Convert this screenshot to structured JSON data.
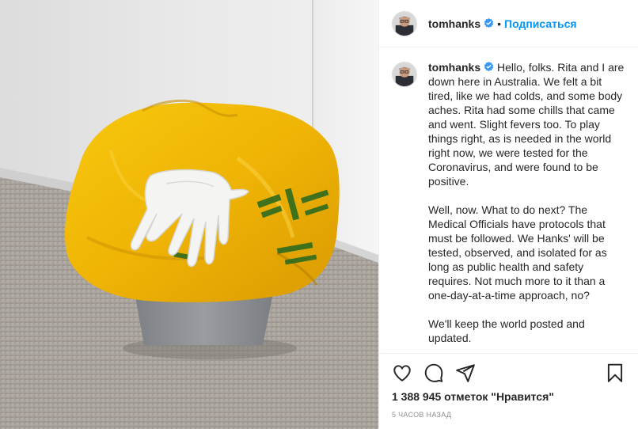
{
  "header": {
    "username": "tomhanks",
    "separator": "•",
    "follow_label": "Подписаться"
  },
  "caption": {
    "username": "tomhanks",
    "paragraphs": [
      "Hello, folks. Rita and I are down here in Australia. We felt a bit tired, like we had colds, and some body aches. Rita had some chills that came and went. Slight fevers too. To play things right, as is needed in the world right now, we were tested for the Coronavirus, and were found to be positive.",
      "Well, now. What to do next? The Medical Officials have protocols that must be followed. We Hanks' will be tested, observed, and isolated for as long as public health and safety requires. Not much more to it than a one-day-at-a-time approach, no?",
      "We'll keep the world posted and updated."
    ]
  },
  "actions": {
    "icons": [
      "heart-icon",
      "comment-icon",
      "share-icon",
      "bookmark-icon"
    ]
  },
  "likes_text": "1 388 945 отметок \"Нравится\"",
  "timestamp": "5 часов назад",
  "colors": {
    "follow": "#0095f6",
    "verified": "#3897f0",
    "bag_yellow": "#f2b807",
    "bag_print": "#2e6b1f",
    "wall": "#e6e6e6",
    "floor": "#a9a39c",
    "bin": "#8f9194"
  }
}
